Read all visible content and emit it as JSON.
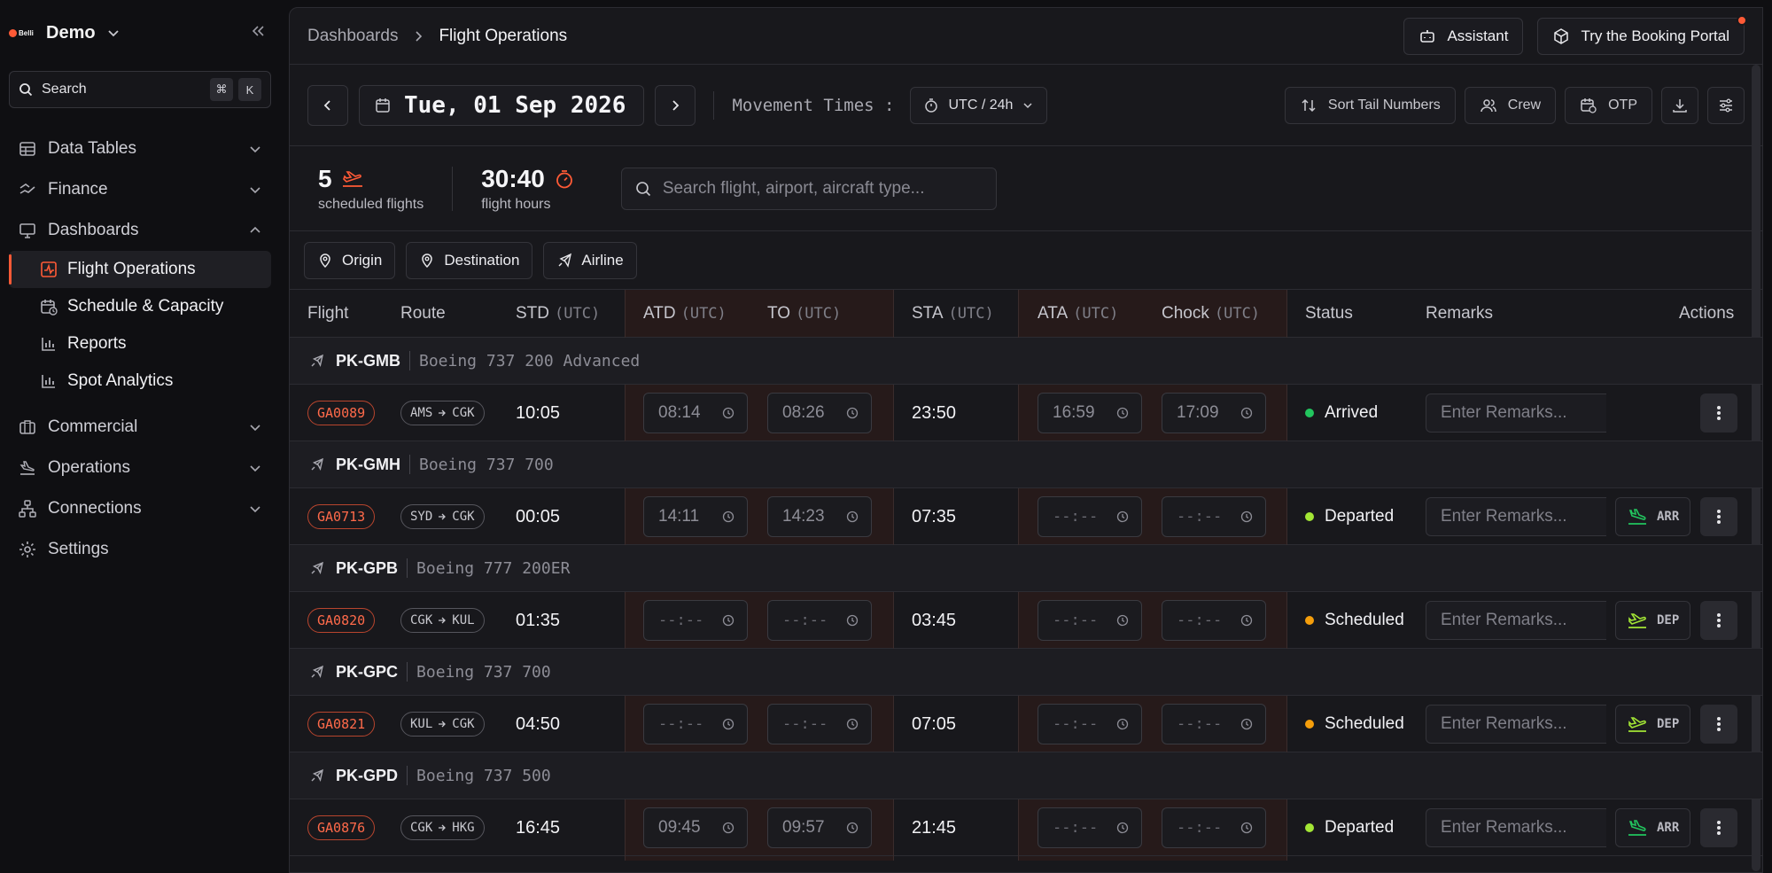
{
  "sidebar": {
    "brand_word": "Belli",
    "workspace": "Demo",
    "search_label": "Search",
    "shortcut": [
      "⌘",
      "K"
    ],
    "nav": [
      {
        "label": "Data Tables"
      },
      {
        "label": "Finance"
      },
      {
        "label": "Dashboards"
      },
      {
        "label": "Commercial"
      },
      {
        "label": "Operations"
      },
      {
        "label": "Connections"
      },
      {
        "label": "Settings"
      }
    ],
    "dashboards_children": [
      {
        "label": "Flight Operations"
      },
      {
        "label": "Schedule & Capacity"
      },
      {
        "label": "Reports"
      },
      {
        "label": "Spot Analytics"
      }
    ]
  },
  "header": {
    "breadcrumb_root": "Dashboards",
    "breadcrumb_current": "Flight Operations",
    "assistant": "Assistant",
    "portal": "Try the Booking Portal"
  },
  "toolbar": {
    "date": "Tue, 01 Sep 2026",
    "movement_label": "Movement Times :",
    "timezone": "UTC / 24h",
    "sort": "Sort Tail Numbers",
    "crew": "Crew",
    "otp": "OTP"
  },
  "stats": {
    "flights": "5",
    "flights_caption": "scheduled flights",
    "hours": "30:40",
    "hours_caption": "flight hours",
    "search_placeholder": "Search flight, airport, aircraft type..."
  },
  "filters": {
    "origin": "Origin",
    "destination": "Destination",
    "airline": "Airline"
  },
  "table": {
    "columns": {
      "flight": "Flight",
      "route": "Route",
      "std": "STD",
      "atd": "ATD",
      "to": "TO",
      "sta": "STA",
      "ata": "ATA",
      "chock": "Chock",
      "status": "Status",
      "remarks": "Remarks",
      "actions": "Actions",
      "utc": "(UTC)"
    },
    "remarks_placeholder": "Enter Remarks...",
    "empty_time": "--:--",
    "groups": [
      {
        "tail": "PK-GMB",
        "type": "Boeing 737 200 Advanced",
        "flight": "GA0089",
        "from": "AMS",
        "to": "CGK",
        "std": "10:05",
        "atd": "08:14",
        "to_time": "08:26",
        "sta": "23:50",
        "ata": "16:59",
        "chock": "17:09",
        "status": "Arrived",
        "status_color": "#22c55e",
        "action": ""
      },
      {
        "tail": "PK-GMH",
        "type": "Boeing 737 700",
        "flight": "GA0713",
        "from": "SYD",
        "to": "CGK",
        "std": "00:05",
        "atd": "14:11",
        "to_time": "14:23",
        "sta": "07:35",
        "ata": "",
        "chock": "",
        "status": "Departed",
        "status_color": "#a3e635",
        "action": "ARR"
      },
      {
        "tail": "PK-GPB",
        "type": "Boeing 777 200ER",
        "flight": "GA0820",
        "from": "CGK",
        "to": "KUL",
        "std": "01:35",
        "atd": "",
        "to_time": "",
        "sta": "03:45",
        "ata": "",
        "chock": "",
        "status": "Scheduled",
        "status_color": "#f59e0b",
        "action": "DEP"
      },
      {
        "tail": "PK-GPC",
        "type": "Boeing 737 700",
        "flight": "GA0821",
        "from": "KUL",
        "to": "CGK",
        "std": "04:50",
        "atd": "",
        "to_time": "",
        "sta": "07:05",
        "ata": "",
        "chock": "",
        "status": "Scheduled",
        "status_color": "#f59e0b",
        "action": "DEP"
      },
      {
        "tail": "PK-GPD",
        "type": "Boeing 737 500",
        "flight": "GA0876",
        "from": "CGK",
        "to": "HKG",
        "std": "16:45",
        "atd": "09:45",
        "to_time": "09:57",
        "sta": "21:45",
        "ata": "",
        "chock": "",
        "status": "Departed",
        "status_color": "#a3e635",
        "action": "ARR"
      }
    ]
  },
  "colors": {
    "accent": "#ff5a36",
    "arr_icon": "#22c55e",
    "dep_icon": "#a3e635"
  }
}
